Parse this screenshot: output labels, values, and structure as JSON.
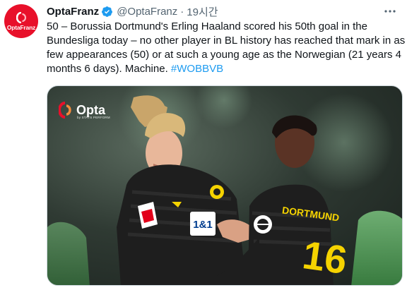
{
  "author": {
    "display_name": "OptaFranz",
    "handle": "@OptaFranz",
    "separator": "·",
    "timestamp": "19시간",
    "avatar_text": "OptaFranz"
  },
  "tweet": {
    "text": "50 – Borussia Dortmund's Erling Haaland scored his 50th goal in the Bundesliga today – no other player in BL history has reached that mark in as few appearances (50) or at such a young age as the Norwegian (21 years 4 months 6 days). Machine. ",
    "hashtag": "#WOBBVB"
  },
  "media": {
    "logo_text": "Opta",
    "logo_subtext": "by STATS PERFORM",
    "shirt_sponsor": "1&1",
    "shirt_name": "DORTMUND",
    "shirt_number": "16"
  },
  "colors": {
    "link": "#1d9bf0",
    "verified": "#1d9bf0",
    "brand": "#e8102a",
    "kit_yellow": "#f5d300"
  },
  "icons": {
    "verified": "verified-badge-icon",
    "more": "more-horizontal-icon"
  }
}
